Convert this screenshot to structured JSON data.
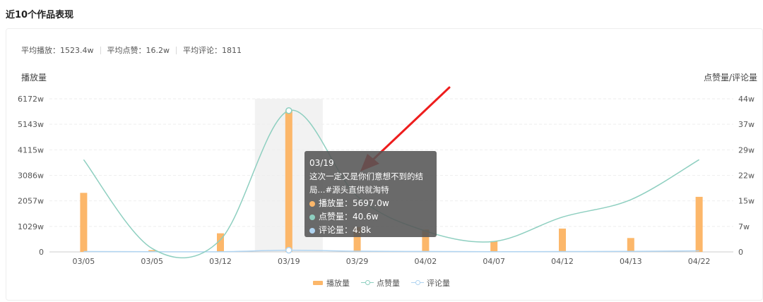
{
  "header": {
    "title": "近10个作品表现"
  },
  "stats": {
    "avg_play": "平均播放：1523.4w",
    "avg_like": "平均点赞：16.2w",
    "avg_comment": "平均评论：1811"
  },
  "colors": {
    "play": "#fcb76a",
    "like": "#8ecfc0",
    "comment": "#b0d4f1",
    "highlight": "#f2f2f2",
    "arrow": "#ee1d1d"
  },
  "chart_data": {
    "type": "bar",
    "categories": [
      "03/05",
      "03/05",
      "03/12",
      "03/19",
      "03/29",
      "04/02",
      "04/07",
      "04/12",
      "04/13",
      "04/22"
    ],
    "left_axis": {
      "label": "播放量",
      "ticks": [
        "0",
        "1029w",
        "2057w",
        "3086w",
        "4115w",
        "5143w",
        "6172w"
      ],
      "ylim": [
        0,
        6172
      ],
      "unit": "w"
    },
    "right_axis": {
      "label": "点赞量/评论量",
      "ticks": [
        "0",
        "7w",
        "15w",
        "22w",
        "29w",
        "37w",
        "44w"
      ],
      "ylim": [
        0,
        44
      ],
      "unit": "w"
    },
    "series": [
      {
        "name": "播放量",
        "type": "bar",
        "axis": "left",
        "values": [
          2380,
          70,
          750,
          5697,
          1000,
          900,
          430,
          940,
          560,
          2220
        ]
      },
      {
        "name": "点赞量",
        "type": "line",
        "axis": "right",
        "values": [
          26.5,
          1.0,
          3.5,
          40.6,
          16.0,
          6.0,
          3.0,
          10.0,
          15.0,
          26.5
        ]
      },
      {
        "name": "评论量",
        "type": "line",
        "axis": "right",
        "values": [
          0.1,
          0.05,
          0.05,
          0.48,
          0.2,
          0.12,
          0.06,
          0.1,
          0.15,
          0.3
        ]
      }
    ],
    "grid": true,
    "legend_position": "bottom-center",
    "highlight_index": 3
  },
  "tooltip": {
    "date": "03/19",
    "title_line1": "这次一定又是你们意想不到的结",
    "title_line2": "局...#源头直供就淘特",
    "rows": [
      {
        "label": "播放量：",
        "value": "5697.0w"
      },
      {
        "label": "点赞量：",
        "value": "40.6w"
      },
      {
        "label": "评论量：",
        "value": "4.8k"
      }
    ]
  }
}
